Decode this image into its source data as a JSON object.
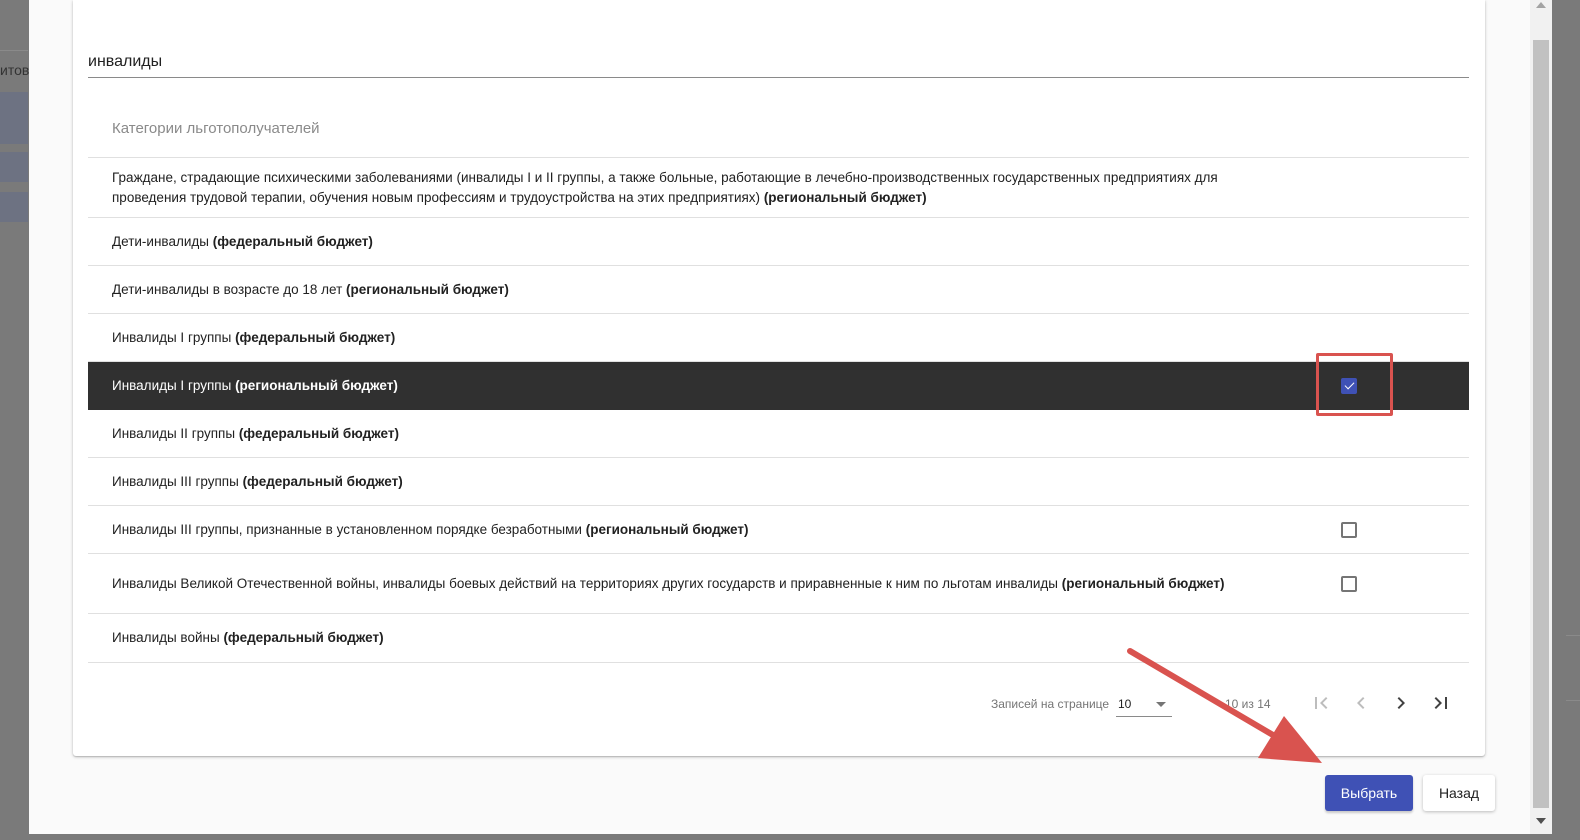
{
  "background": {
    "left_text": "итов"
  },
  "search": {
    "value": "инвалиды"
  },
  "table": {
    "header": "Категории льготополучателей",
    "rows": [
      {
        "text": "Граждане, страдающие психическими заболеваниями (инвалиды I и II группы, а также больные, работающие в лечебно-производственных государственных предприятиях для проведения трудовой терапии, обучения новым профессиям и трудоустройства на этих предприятиях)",
        "budget": "(региональный бюджет)"
      },
      {
        "text": "Дети-инвалиды",
        "budget": "(федеральный бюджет)"
      },
      {
        "text": "Дети-инвалиды в возрасте до 18 лет",
        "budget": "(региональный бюджет)"
      },
      {
        "text": "Инвалиды I группы",
        "budget": "(федеральный бюджет)"
      },
      {
        "text": "Инвалиды I группы",
        "budget": "(региональный бюджет)",
        "selected": true,
        "checked": true
      },
      {
        "text": "Инвалиды II группы",
        "budget": "(федеральный бюджет)"
      },
      {
        "text": "Инвалиды III группы",
        "budget": "(федеральный бюджет)"
      },
      {
        "text": "Инвалиды III группы, признанные в установленном порядке безработными",
        "budget": "(региональный бюджет)",
        "checked": false
      },
      {
        "text": "Инвалиды Великой Отечественной войны, инвалиды боевых действий на территориях других государств и приравненные к ним по льготам инвалиды",
        "budget": "(региональный бюджет)",
        "checked": false
      },
      {
        "text": "Инвалиды войны",
        "budget": "(федеральный бюджет)"
      }
    ]
  },
  "pager": {
    "rows_label": "Записей на странице",
    "rows_value": "10",
    "range": "10 из 14"
  },
  "buttons": {
    "select": "Выбрать",
    "back": "Назад"
  },
  "colors": {
    "primary": "#3f51b5",
    "selected_row": "#303030",
    "annotation": "#d9534f"
  },
  "icons": [
    "first-page-icon",
    "prev-page-icon",
    "next-page-icon",
    "last-page-icon",
    "checkbox-checked-icon",
    "checkbox-icon"
  ]
}
